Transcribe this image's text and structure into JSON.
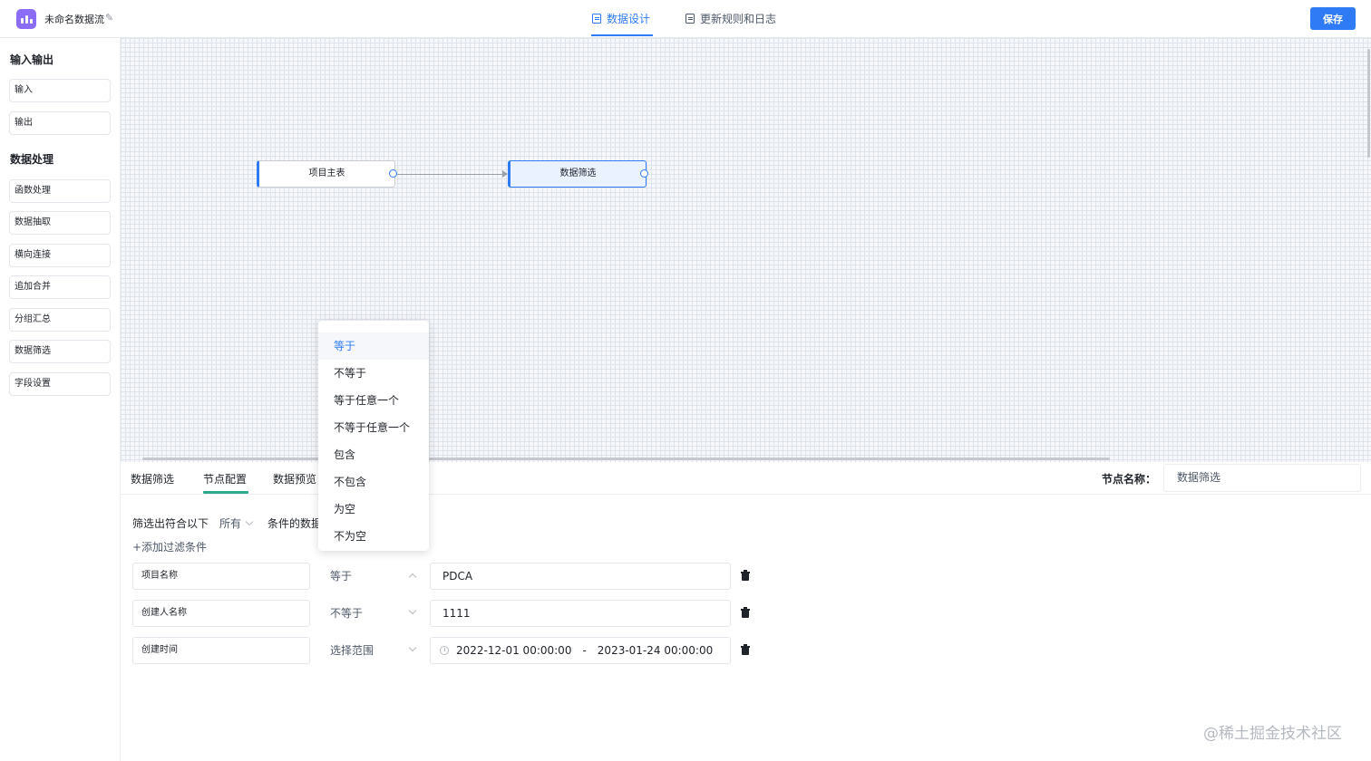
{
  "header": {
    "app_title": "未命名数据流",
    "tabs": [
      {
        "label": "数据设计",
        "icon": "design-doc-icon",
        "active": true
      },
      {
        "label": "更新规则和日志",
        "icon": "log-doc-icon",
        "active": false
      }
    ],
    "save_label": "保存",
    "accent_color": "#2f7bf6"
  },
  "sidebar": {
    "groups": [
      {
        "title": "输入输出",
        "items": [
          "输入",
          "输出"
        ]
      },
      {
        "title": "数据处理",
        "items": [
          "函数处理",
          "数据抽取",
          "横向连接",
          "追加合并",
          "分组汇总",
          "数据筛选",
          "字段设置"
        ]
      }
    ]
  },
  "canvas": {
    "nodes": [
      {
        "label": "项目主表",
        "selected": false
      },
      {
        "label": "数据筛选",
        "selected": true
      }
    ]
  },
  "panel": {
    "tabs": [
      "数据筛选",
      "节点配置",
      "数据预览"
    ],
    "active_tab": "节点配置",
    "node_name_label": "节点名称：",
    "node_name_value": "数据筛选",
    "filter_prefix": "筛选出符合以下",
    "match_mode": "所有",
    "filter_suffix": "条件的数据",
    "add_filter_label": "+添加过滤条件",
    "conditions": [
      {
        "field": "项目名称",
        "operator": "等于",
        "value": "PDCA",
        "open": true
      },
      {
        "field": "创建人名称",
        "operator": "不等于",
        "value": "1111",
        "open": false
      },
      {
        "field": "创建时间",
        "operator": "选择范围",
        "start": "2022-12-01 00:00:00",
        "separator": "-",
        "end": "2023-01-24 00:00:00",
        "open": false
      }
    ]
  },
  "dropdown": {
    "options": [
      "等于",
      "不等于",
      "等于任意一个",
      "不等于任意一个",
      "包含",
      "不包含",
      "为空",
      "不为空"
    ],
    "selected": "等于"
  },
  "watermark": "@稀土掘金技术社区"
}
